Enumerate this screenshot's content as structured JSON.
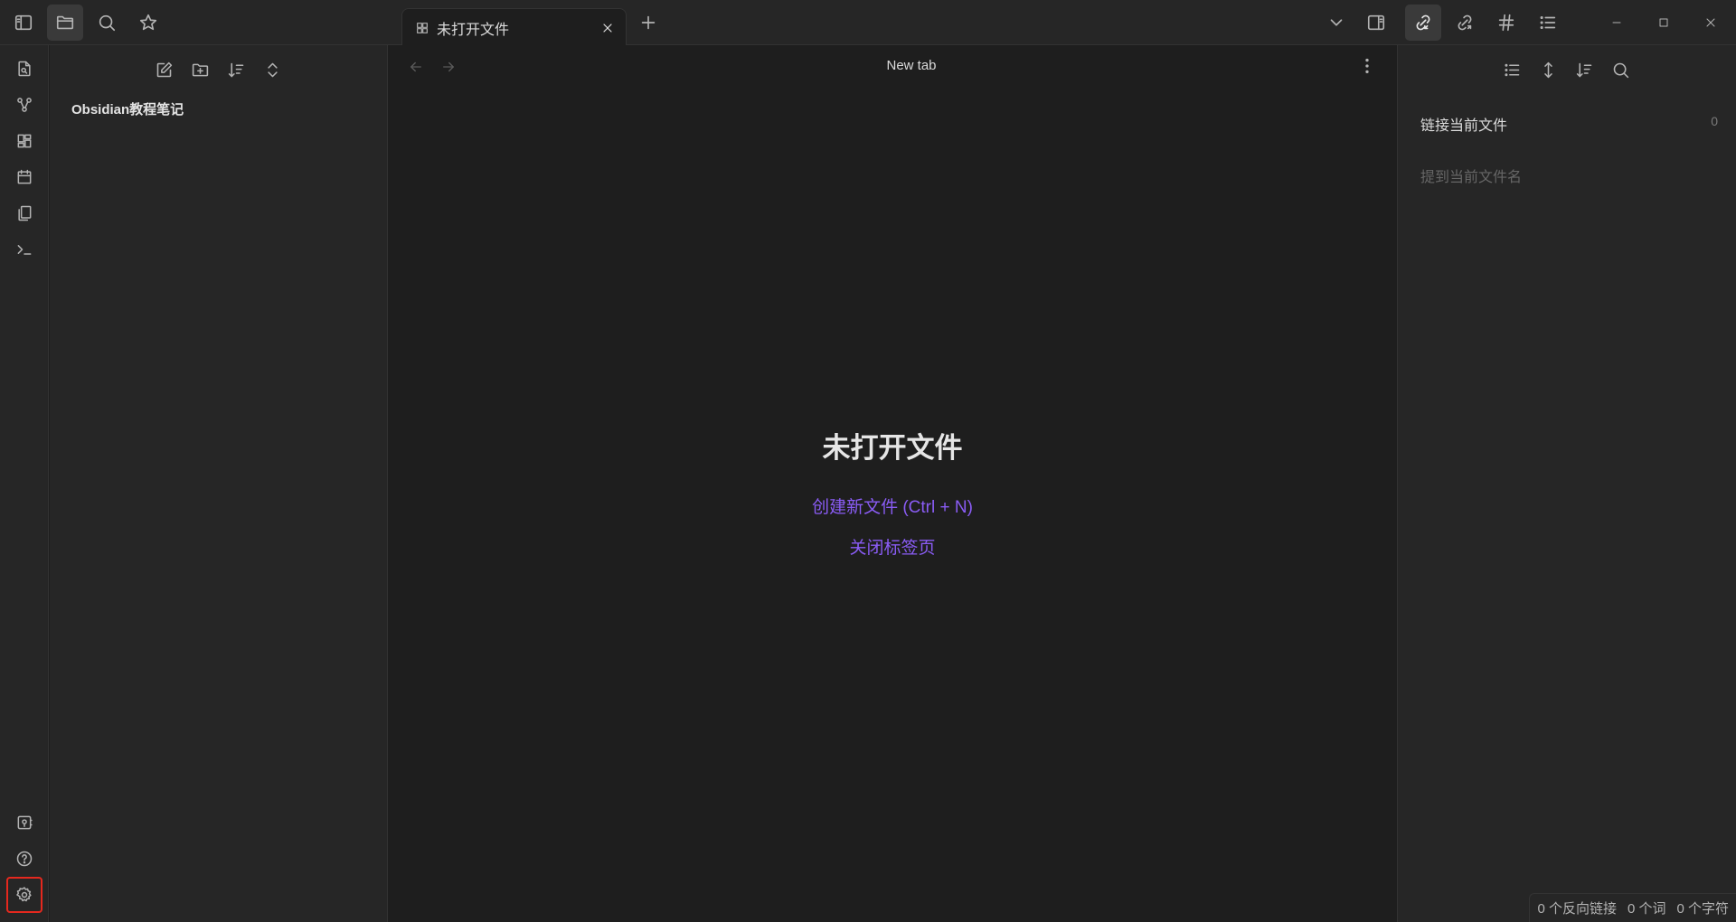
{
  "titlebar": {
    "tab": {
      "label": "未打开文件",
      "icon": "layout-grid-icon"
    }
  },
  "main": {
    "view_title": "New tab",
    "empty_title": "未打开文件",
    "create_link": "创建新文件 (Ctrl + N)",
    "close_link": "关闭标签页"
  },
  "explorer": {
    "vault_name": "Obsidian教程笔记"
  },
  "rightbar": {
    "linked_header": "链接当前文件",
    "linked_count": "0",
    "unlinked_header": "提到当前文件名"
  },
  "statusbar": {
    "backlinks": "0 个反向链接",
    "words": "0 个词",
    "chars": "0 个字符"
  },
  "colors": {
    "accent": "#8a5cf5",
    "highlight": "#e5281e",
    "background": "#1e1e1e",
    "sidebar": "#262626"
  }
}
